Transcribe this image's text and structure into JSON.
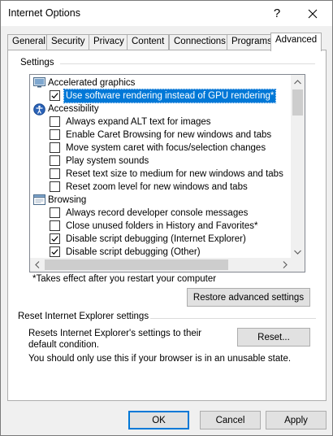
{
  "window": {
    "title": "Internet Options",
    "help_glyph": "?",
    "close_icon": "close-icon"
  },
  "tabs": [
    {
      "label": "General"
    },
    {
      "label": "Security"
    },
    {
      "label": "Privacy"
    },
    {
      "label": "Content"
    },
    {
      "label": "Connections"
    },
    {
      "label": "Programs"
    },
    {
      "label": "Advanced",
      "active": true
    }
  ],
  "settings": {
    "group_label": "Settings",
    "rows": [
      {
        "type": "category",
        "icon": "monitor-icon",
        "label": "Accelerated graphics"
      },
      {
        "type": "option",
        "checked": true,
        "selected": true,
        "label": "Use software rendering instead of GPU rendering*"
      },
      {
        "type": "category",
        "icon": "accessibility-icon",
        "label": "Accessibility"
      },
      {
        "type": "option",
        "checked": false,
        "label": "Always expand ALT text for images"
      },
      {
        "type": "option",
        "checked": false,
        "label": "Enable Caret Browsing for new windows and tabs"
      },
      {
        "type": "option",
        "checked": false,
        "label": "Move system caret with focus/selection changes"
      },
      {
        "type": "option",
        "checked": false,
        "label": "Play system sounds"
      },
      {
        "type": "option",
        "checked": false,
        "label": "Reset text size to medium for new windows and tabs"
      },
      {
        "type": "option",
        "checked": false,
        "label": "Reset zoom level for new windows and tabs"
      },
      {
        "type": "category",
        "icon": "browser-window-icon",
        "label": "Browsing"
      },
      {
        "type": "option",
        "checked": false,
        "label": "Always record developer console messages"
      },
      {
        "type": "option",
        "checked": false,
        "label": "Close unused folders in History and Favorites*"
      },
      {
        "type": "option",
        "checked": true,
        "label": "Disable script debugging (Internet Explorer)"
      },
      {
        "type": "option",
        "checked": true,
        "label": "Disable script debugging (Other)"
      }
    ],
    "note": "*Takes effect after you restart your computer",
    "restore_button": "Restore advanced settings"
  },
  "reset": {
    "section_label": "Reset Internet Explorer settings",
    "description": "Resets Internet Explorer's settings to their default condition.",
    "button": "Reset...",
    "warning": "You should only use this if your browser is in an unusable state."
  },
  "footer": {
    "ok": "OK",
    "cancel": "Cancel",
    "apply": "Apply"
  },
  "colors": {
    "selection": "#0078d7",
    "button_face": "#e1e1e1",
    "dialog_bg": "#f0f0f0"
  }
}
